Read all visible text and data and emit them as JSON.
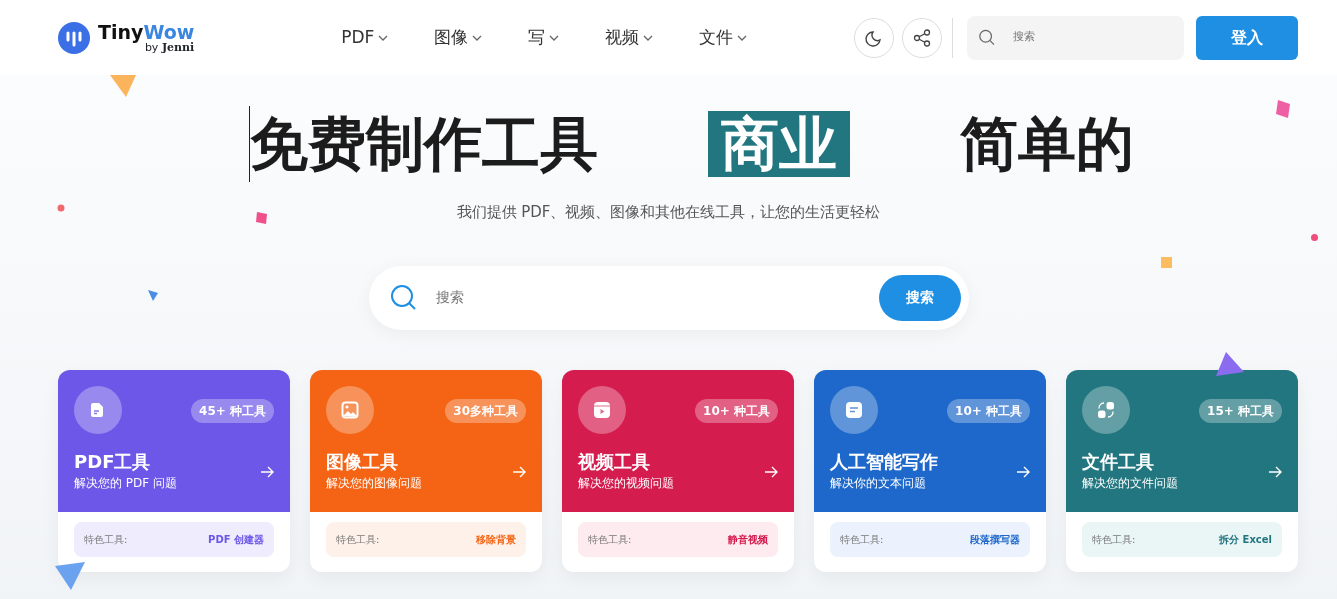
{
  "logo": {
    "name_a": "Tiny",
    "name_b": "Wow",
    "byline_a": "by",
    "byline_b": "Jenni"
  },
  "nav": [
    {
      "label": "PDF"
    },
    {
      "label": "图像"
    },
    {
      "label": "写"
    },
    {
      "label": "视频"
    },
    {
      "label": "文件"
    }
  ],
  "header_search": {
    "placeholder": "搜索"
  },
  "login_button": "登入",
  "hero": {
    "title_parts": [
      {
        "text": "免费制作工具",
        "highlighted": false
      },
      {
        "text": "商业",
        "highlighted": true
      },
      {
        "text": "简单的",
        "highlighted": false
      }
    ],
    "subtitle": "我们提供 PDF、视频、图像和其他在线工具，让您的生活更轻松"
  },
  "search": {
    "placeholder": "搜索",
    "button": "搜索"
  },
  "categories": [
    {
      "kind": "pdf",
      "color": "#6c57e8",
      "count": "45+ 种工具",
      "title": "PDF工具",
      "subtitle": "解决您的 PDF 问题",
      "featured_label": "特色工具:",
      "featured_tool": "PDF 创建器"
    },
    {
      "kind": "image",
      "color": "#f46414",
      "count": "30多种工具",
      "title": "图像工具",
      "subtitle": "解决您的图像问题",
      "featured_label": "特色工具:",
      "featured_tool": "移除背景"
    },
    {
      "kind": "video",
      "color": "#d41c4e",
      "count": "10+ 种工具",
      "title": "视频工具",
      "subtitle": "解决您的视频问题",
      "featured_label": "特色工具:",
      "featured_tool": "静音视频"
    },
    {
      "kind": "write",
      "color": "#1d68ca",
      "count": "10+ 种工具",
      "title": "人工智能写作",
      "subtitle": "解决你的文本问题",
      "featured_label": "特色工具:",
      "featured_tool": "段落撰写器"
    },
    {
      "kind": "file",
      "color": "#22767f",
      "count": "15+ 种工具",
      "title": "文件工具",
      "subtitle": "解决您的文件问题",
      "featured_label": "特色工具:",
      "featured_tool": "拆分 Excel"
    }
  ]
}
